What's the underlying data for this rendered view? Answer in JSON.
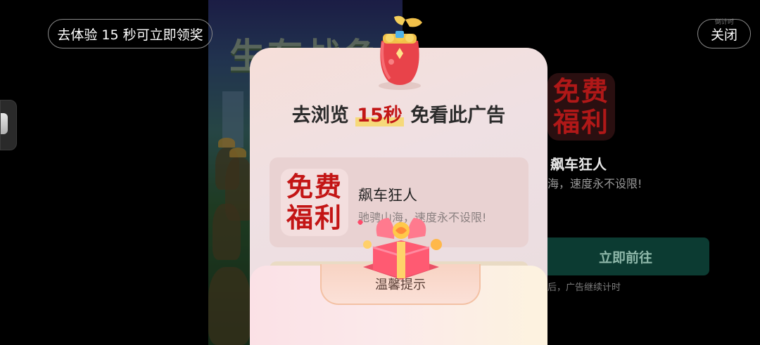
{
  "top_bar": {
    "reward_label": "去体验 15 秒可立即领奖",
    "close_label": "关闭",
    "close_small_label": "倒计时"
  },
  "background_ad": {
    "art_title": "生存战争",
    "logo_line1": "免费",
    "logo_line2": "福利",
    "app_name": "飙车狂人",
    "app_desc": "海，速度永不设限!",
    "cta_label": "立即前往",
    "note": "后，广告继续计时"
  },
  "modal": {
    "title_prefix": "去浏览",
    "title_highlight": "15秒",
    "title_suffix": "免看此广告",
    "ad": {
      "logo_line1": "免费",
      "logo_line2": "福利",
      "app_name": "飙车狂人",
      "app_desc": "驰骋山海，速度永不设限!"
    },
    "tip_label": "温馨提示"
  },
  "icons": [
    "lucky-bag-icon",
    "gift-box-icon"
  ],
  "colors": {
    "highlight_red": "#c21616",
    "cta_green": "#0c3b32",
    "logo_red": "#c31515"
  }
}
